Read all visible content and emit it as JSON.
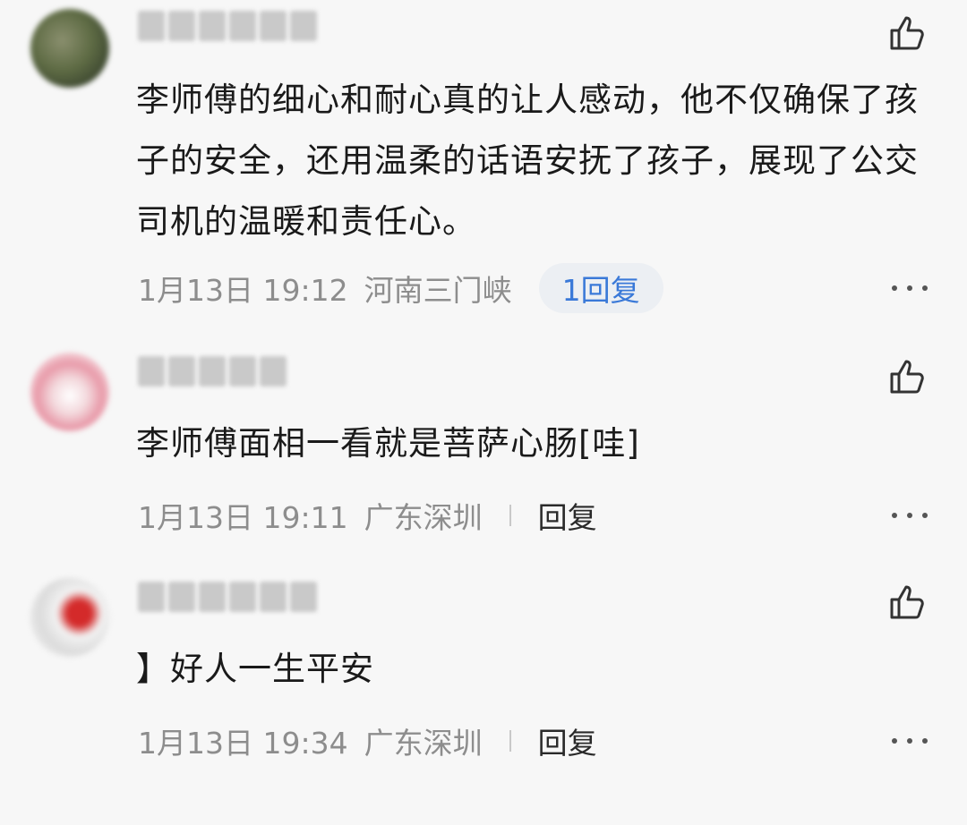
{
  "comments": [
    {
      "text": "李师傅的细心和耐心真的让人感动，他不仅确保了孩子的安全，还用温柔的话语安抚了孩子，展现了公交司机的温暖和责任心。",
      "time": "1月13日 19:12",
      "location": "河南三门峡",
      "reply_label": "1回复"
    },
    {
      "text": "李师傅面相一看就是菩萨心肠[哇]",
      "time": "1月13日 19:11",
      "location": "广东深圳",
      "reply_label": "回复"
    },
    {
      "text": "】好人一生平安",
      "time": "1月13日 19:34",
      "location": "广东深圳",
      "reply_label": "回复"
    }
  ],
  "icons": {
    "like": "thumbs-up-icon",
    "more": "more-dots-icon"
  },
  "colors": {
    "background": "#f7f7f7",
    "reply_pill_text": "#3a79d8",
    "meta_text": "#8d8d8d"
  }
}
